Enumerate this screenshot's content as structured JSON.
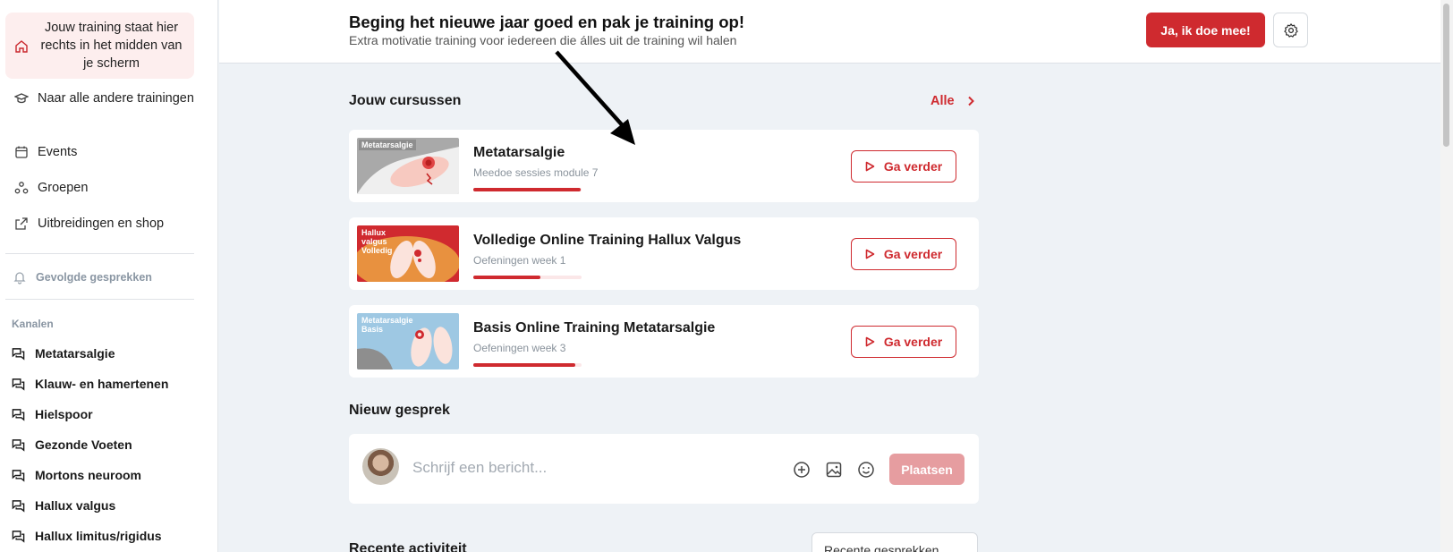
{
  "sidebar": {
    "active_item": "Jouw training staat hier rechts in het midden van je scherm",
    "items": [
      "Naar alle andere trainingen",
      "Events",
      "Groepen",
      "Uitbreidingen en shop"
    ],
    "followed": "Gevolgde gesprekken",
    "channels_title": "Kanalen",
    "channels": [
      "Metatarsalgie",
      "Klauw- en hamertenen",
      "Hielspoor",
      "Gezonde Voeten",
      "Mortons neuroom",
      "Hallux valgus",
      "Hallux limitus/rigidus"
    ]
  },
  "banner": {
    "title": "Beging het nieuwe jaar goed en pak je training op!",
    "subtitle": "Extra motivatie training voor iedereen die álles uit de training wil halen",
    "join_label": "Ja, ik doe mee!"
  },
  "courses": {
    "title": "Jouw cursussen",
    "all_label": "Alle",
    "items": [
      {
        "tag": "Metatarsalgie",
        "title": "Metatarsalgie",
        "subtitle": "Meedoe sessies module 7",
        "progress": 0.99,
        "button": "Ga verder",
        "color": "#a9a9a9"
      },
      {
        "tag": "Hallux valgus Volledig",
        "title": "Volledige Online Training Hallux Valgus",
        "subtitle": "Oefeningen week 1",
        "progress": 0.62,
        "button": "Ga verder",
        "color": "#e8913f"
      },
      {
        "tag": "Metatarsalgie Basis",
        "title": "Basis Online Training Metatarsalgie",
        "subtitle": "Oefeningen week 3",
        "progress": 0.94,
        "button": "Ga verder",
        "color": "#9ec8e3"
      }
    ]
  },
  "new_conversation": {
    "title": "Nieuw gesprek",
    "placeholder": "Schrijf een bericht...",
    "post_label": "Plaatsen"
  },
  "recent": {
    "title": "Recente activiteit",
    "sort_value": "Recente gesprekken"
  },
  "colors": {
    "accent": "#cf2a2f",
    "background": "#eef2f6"
  }
}
